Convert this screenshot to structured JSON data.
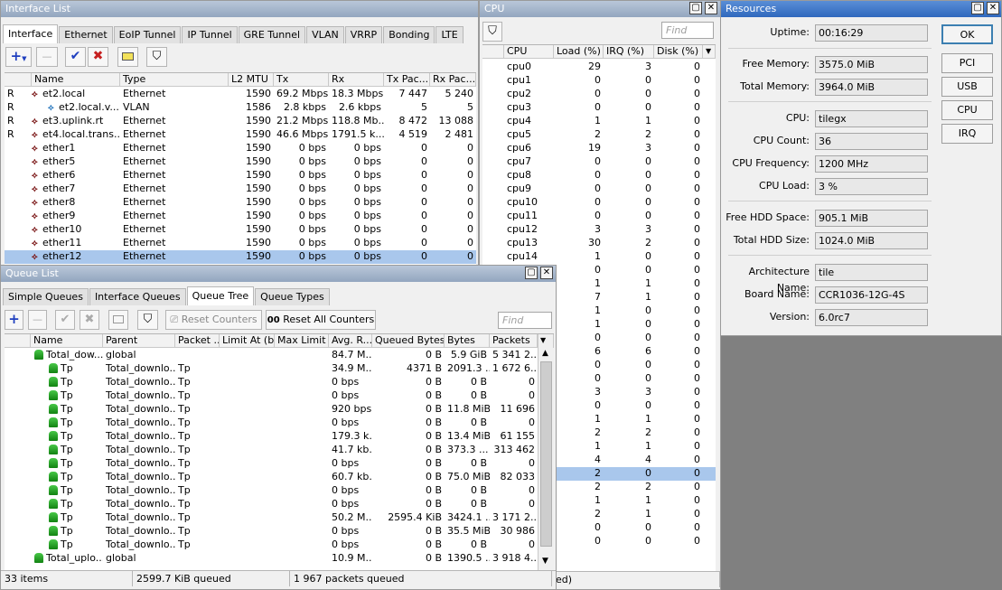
{
  "interface_list": {
    "title": "Interface List",
    "tabs": [
      "Interface",
      "Ethernet",
      "EoIP Tunnel",
      "IP Tunnel",
      "GRE Tunnel",
      "VLAN",
      "VRRP",
      "Bonding",
      "LTE"
    ],
    "find_placeholder": "Find",
    "columns": [
      "Name",
      "Type",
      "L2 MTU",
      "Tx",
      "Rx",
      "Tx Pac...",
      "Rx Pac..."
    ],
    "rows": [
      {
        "flag": "R",
        "name": "et2.local",
        "type": "Ethernet",
        "mtu": "1590",
        "tx": "69.2 Mbps",
        "rx": "18.3 Mbps",
        "txp": "7 447",
        "rxp": "5 240"
      },
      {
        "flag": "R",
        "name": "et2.local.v...",
        "type": "VLAN",
        "mtu": "1586",
        "tx": "2.8 kbps",
        "rx": "2.6 kbps",
        "txp": "5",
        "rxp": "5"
      },
      {
        "flag": "R",
        "name": "et3.uplink.rt",
        "type": "Ethernet",
        "mtu": "1590",
        "tx": "21.2 Mbps",
        "rx": "118.8 Mb...",
        "txp": "8 472",
        "rxp": "13 088"
      },
      {
        "flag": "R",
        "name": "et4.local.trans...",
        "type": "Ethernet",
        "mtu": "1590",
        "tx": "46.6 Mbps",
        "rx": "1791.5 k...",
        "txp": "4 519",
        "rxp": "2 481"
      },
      {
        "flag": "",
        "name": "ether1",
        "type": "Ethernet",
        "mtu": "1590",
        "tx": "0 bps",
        "rx": "0 bps",
        "txp": "0",
        "rxp": "0"
      },
      {
        "flag": "",
        "name": "ether5",
        "type": "Ethernet",
        "mtu": "1590",
        "tx": "0 bps",
        "rx": "0 bps",
        "txp": "0",
        "rxp": "0"
      },
      {
        "flag": "",
        "name": "ether6",
        "type": "Ethernet",
        "mtu": "1590",
        "tx": "0 bps",
        "rx": "0 bps",
        "txp": "0",
        "rxp": "0"
      },
      {
        "flag": "",
        "name": "ether7",
        "type": "Ethernet",
        "mtu": "1590",
        "tx": "0 bps",
        "rx": "0 bps",
        "txp": "0",
        "rxp": "0"
      },
      {
        "flag": "",
        "name": "ether8",
        "type": "Ethernet",
        "mtu": "1590",
        "tx": "0 bps",
        "rx": "0 bps",
        "txp": "0",
        "rxp": "0"
      },
      {
        "flag": "",
        "name": "ether9",
        "type": "Ethernet",
        "mtu": "1590",
        "tx": "0 bps",
        "rx": "0 bps",
        "txp": "0",
        "rxp": "0"
      },
      {
        "flag": "",
        "name": "ether10",
        "type": "Ethernet",
        "mtu": "1590",
        "tx": "0 bps",
        "rx": "0 bps",
        "txp": "0",
        "rxp": "0"
      },
      {
        "flag": "",
        "name": "ether11",
        "type": "Ethernet",
        "mtu": "1590",
        "tx": "0 bps",
        "rx": "0 bps",
        "txp": "0",
        "rxp": "0"
      },
      {
        "flag": "",
        "name": "ether12",
        "type": "Ethernet",
        "mtu": "1590",
        "tx": "0 bps",
        "rx": "0 bps",
        "txp": "0",
        "rxp": "0",
        "selected": true
      }
    ]
  },
  "cpu": {
    "title": "CPU",
    "find_placeholder": "Find",
    "columns": [
      "CPU",
      "Load (%)",
      "IRQ (%)",
      "Disk (%)"
    ],
    "rows": [
      {
        "cpu": "cpu0",
        "load": "29",
        "irq": "3",
        "disk": "0"
      },
      {
        "cpu": "cpu1",
        "load": "0",
        "irq": "0",
        "disk": "0"
      },
      {
        "cpu": "cpu2",
        "load": "0",
        "irq": "0",
        "disk": "0"
      },
      {
        "cpu": "cpu3",
        "load": "0",
        "irq": "0",
        "disk": "0"
      },
      {
        "cpu": "cpu4",
        "load": "1",
        "irq": "1",
        "disk": "0"
      },
      {
        "cpu": "cpu5",
        "load": "2",
        "irq": "2",
        "disk": "0"
      },
      {
        "cpu": "cpu6",
        "load": "19",
        "irq": "3",
        "disk": "0"
      },
      {
        "cpu": "cpu7",
        "load": "0",
        "irq": "0",
        "disk": "0"
      },
      {
        "cpu": "cpu8",
        "load": "0",
        "irq": "0",
        "disk": "0"
      },
      {
        "cpu": "cpu9",
        "load": "0",
        "irq": "0",
        "disk": "0"
      },
      {
        "cpu": "cpu10",
        "load": "0",
        "irq": "0",
        "disk": "0"
      },
      {
        "cpu": "cpu11",
        "load": "0",
        "irq": "0",
        "disk": "0"
      },
      {
        "cpu": "cpu12",
        "load": "3",
        "irq": "3",
        "disk": "0"
      },
      {
        "cpu": "cpu13",
        "load": "30",
        "irq": "2",
        "disk": "0"
      },
      {
        "cpu": "cpu14",
        "load": "1",
        "irq": "0",
        "disk": "0"
      },
      {
        "cpu": "",
        "load": "0",
        "irq": "0",
        "disk": "0"
      },
      {
        "cpu": "",
        "load": "1",
        "irq": "1",
        "disk": "0"
      },
      {
        "cpu": "",
        "load": "7",
        "irq": "1",
        "disk": "0"
      },
      {
        "cpu": "",
        "load": "1",
        "irq": "0",
        "disk": "0"
      },
      {
        "cpu": "",
        "load": "1",
        "irq": "0",
        "disk": "0"
      },
      {
        "cpu": "",
        "load": "0",
        "irq": "0",
        "disk": "0"
      },
      {
        "cpu": "",
        "load": "6",
        "irq": "6",
        "disk": "0"
      },
      {
        "cpu": "",
        "load": "0",
        "irq": "0",
        "disk": "0"
      },
      {
        "cpu": "",
        "load": "0",
        "irq": "0",
        "disk": "0"
      },
      {
        "cpu": "",
        "load": "3",
        "irq": "3",
        "disk": "0"
      },
      {
        "cpu": "",
        "load": "0",
        "irq": "0",
        "disk": "0"
      },
      {
        "cpu": "",
        "load": "1",
        "irq": "1",
        "disk": "0"
      },
      {
        "cpu": "",
        "load": "2",
        "irq": "2",
        "disk": "0"
      },
      {
        "cpu": "",
        "load": "1",
        "irq": "1",
        "disk": "0"
      },
      {
        "cpu": "",
        "load": "4",
        "irq": "4",
        "disk": "0"
      },
      {
        "cpu": "",
        "load": "2",
        "irq": "0",
        "disk": "0",
        "selected": true
      },
      {
        "cpu": "",
        "load": "2",
        "irq": "2",
        "disk": "0"
      },
      {
        "cpu": "",
        "load": "1",
        "irq": "1",
        "disk": "0"
      },
      {
        "cpu": "",
        "load": "2",
        "irq": "1",
        "disk": "0"
      },
      {
        "cpu": "",
        "load": "0",
        "irq": "0",
        "disk": "0"
      },
      {
        "cpu": "",
        "load": "0",
        "irq": "0",
        "disk": "0"
      }
    ],
    "status": "ed)"
  },
  "resources": {
    "title": "Resources",
    "buttons": [
      "OK",
      "PCI",
      "USB",
      "CPU",
      "IRQ"
    ],
    "fields": [
      {
        "label": "Uptime:",
        "value": "00:16:29"
      },
      {
        "label": "Free Memory:",
        "value": "3575.0 MiB"
      },
      {
        "label": "Total Memory:",
        "value": "3964.0 MiB"
      },
      {
        "label": "CPU:",
        "value": "tilegx"
      },
      {
        "label": "CPU Count:",
        "value": "36"
      },
      {
        "label": "CPU Frequency:",
        "value": "1200 MHz"
      },
      {
        "label": "CPU Load:",
        "value": "3 %"
      },
      {
        "label": "Free HDD Space:",
        "value": "905.1 MiB"
      },
      {
        "label": "Total HDD Size:",
        "value": "1024.0 MiB"
      },
      {
        "label": "Architecture Name:",
        "value": "tile"
      },
      {
        "label": "Board Name:",
        "value": "CCR1036-12G-4S"
      },
      {
        "label": "Version:",
        "value": "6.0rc7"
      }
    ]
  },
  "queue_list": {
    "title": "Queue List",
    "tabs": [
      "Simple Queues",
      "Interface Queues",
      "Queue Tree",
      "Queue Types"
    ],
    "reset_counters": "Reset Counters",
    "reset_all_counters": "Reset All Counters",
    "reset_all_glyph": "00",
    "find_placeholder": "Find",
    "columns": [
      "Name",
      "Parent",
      "Packet ...",
      "Limit At (b...",
      "Max Limit ...",
      "Avg. R...",
      "Queued Bytes",
      "Bytes",
      "Packets"
    ],
    "rows": [
      {
        "level": 0,
        "name": "Total_dow...",
        "parent": "global",
        "mark": "",
        "avg": "84.7 M...",
        "queued": "0 B",
        "bytes": "5.9 GiB",
        "packets": "5 341 2..."
      },
      {
        "level": 1,
        "name": "Tp",
        "parent": "Total_downlo...",
        "mark": "Tp",
        "avg": "34.9 M...",
        "queued": "4371 B",
        "bytes": "2091.3 ...",
        "packets": "1 672 6..."
      },
      {
        "level": 1,
        "name": "Tp",
        "parent": "Total_downlo...",
        "mark": "Tp",
        "avg": "0 bps",
        "queued": "0 B",
        "bytes": "0 B",
        "packets": "0"
      },
      {
        "level": 1,
        "name": "Tp",
        "parent": "Total_downlo...",
        "mark": "Tp",
        "avg": "0 bps",
        "queued": "0 B",
        "bytes": "0 B",
        "packets": "0"
      },
      {
        "level": 1,
        "name": "Tp",
        "parent": "Total_downlo...",
        "mark": "Tp",
        "avg": "920 bps",
        "queued": "0 B",
        "bytes": "11.8 MiB",
        "packets": "11 696"
      },
      {
        "level": 1,
        "name": "Tp",
        "parent": "Total_downlo...",
        "mark": "Tp",
        "avg": "0 bps",
        "queued": "0 B",
        "bytes": "0 B",
        "packets": "0"
      },
      {
        "level": 1,
        "name": "Tp",
        "parent": "Total_downlo...",
        "mark": "Tp",
        "avg": "179.3 k...",
        "queued": "0 B",
        "bytes": "13.4 MiB",
        "packets": "61 155"
      },
      {
        "level": 1,
        "name": "Tp",
        "parent": "Total_downlo...",
        "mark": "Tp",
        "avg": "41.7 kb...",
        "queued": "0 B",
        "bytes": "373.3 ...",
        "packets": "313 462"
      },
      {
        "level": 1,
        "name": "Tp",
        "parent": "Total_downlo...",
        "mark": "Tp",
        "avg": "0 bps",
        "queued": "0 B",
        "bytes": "0 B",
        "packets": "0"
      },
      {
        "level": 1,
        "name": "Tp",
        "parent": "Total_downlo...",
        "mark": "Tp",
        "avg": "60.7 kb...",
        "queued": "0 B",
        "bytes": "75.0 MiB",
        "packets": "82 033"
      },
      {
        "level": 1,
        "name": "Tp",
        "parent": "Total_downlo...",
        "mark": "Tp",
        "avg": "0 bps",
        "queued": "0 B",
        "bytes": "0 B",
        "packets": "0"
      },
      {
        "level": 1,
        "name": "Tp",
        "parent": "Total_downlo...",
        "mark": "Tp",
        "avg": "0 bps",
        "queued": "0 B",
        "bytes": "0 B",
        "packets": "0"
      },
      {
        "level": 1,
        "name": "Tp",
        "parent": "Total_downlo...",
        "mark": "Tp",
        "avg": "50.2 M...",
        "queued": "2595.4 KiB",
        "bytes": "3424.1 ...",
        "packets": "3 171 2..."
      },
      {
        "level": 1,
        "name": "Tp",
        "parent": "Total_downlo...",
        "mark": "Tp",
        "avg": "0 bps",
        "queued": "0 B",
        "bytes": "35.5 MiB",
        "packets": "30 986"
      },
      {
        "level": 1,
        "name": "Tp",
        "parent": "Total_downlo...",
        "mark": "Tp",
        "avg": "0 bps",
        "queued": "0 B",
        "bytes": "0 B",
        "packets": "0"
      },
      {
        "level": 0,
        "name": "Total_uplo...",
        "parent": "global",
        "mark": "",
        "avg": "10.9 M...",
        "queued": "0 B",
        "bytes": "1390.5 ...",
        "packets": "3 918 4..."
      }
    ],
    "status": {
      "items": "33 items",
      "queued": "2599.7 KiB queued",
      "packets": "1 967 packets queued"
    }
  },
  "colors": {
    "titlebar_active": "#2f68be",
    "selection": "#a9c7ec",
    "add": "#1f3fbf",
    "remove": "#c62020",
    "check": "#1f3fbf"
  }
}
